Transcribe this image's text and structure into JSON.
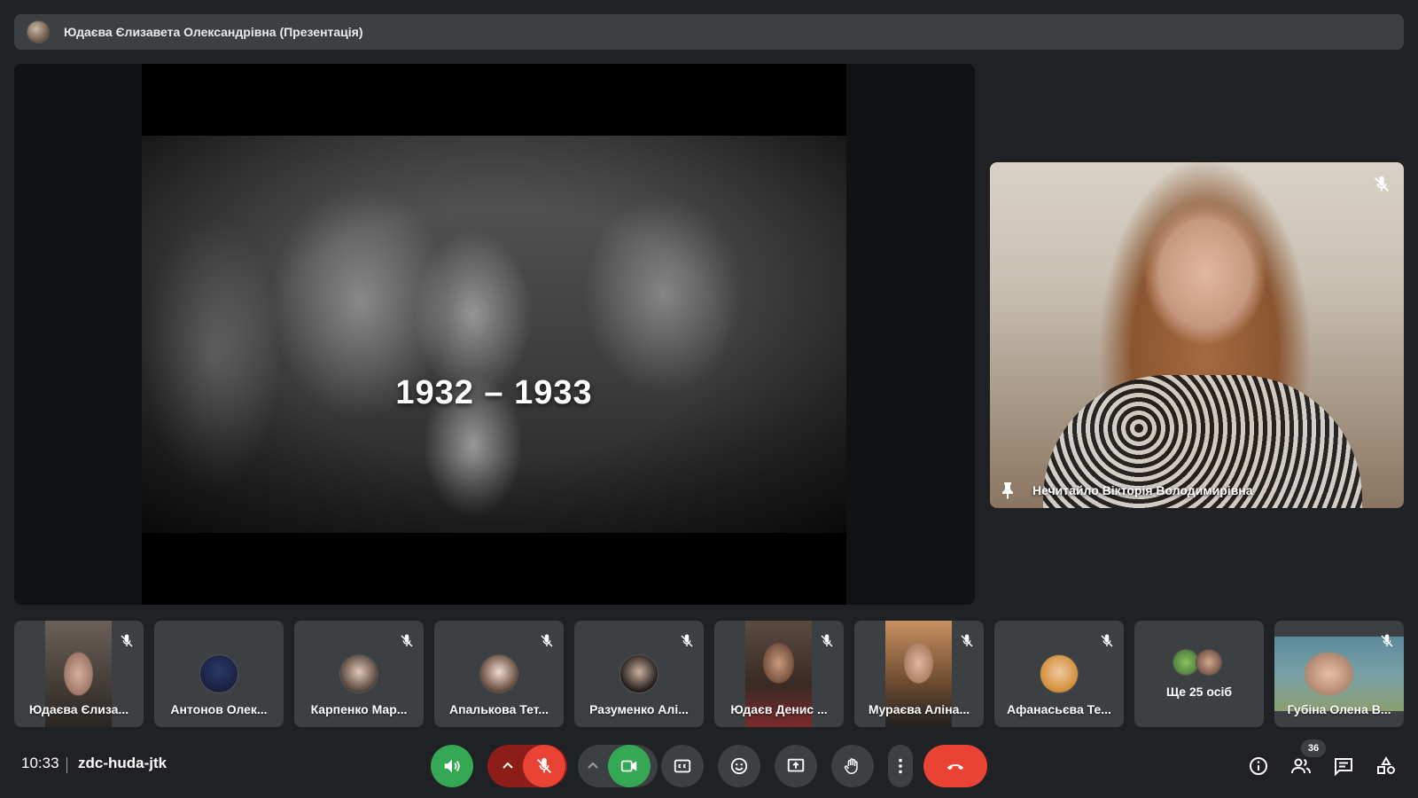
{
  "presenter": {
    "name": "Юдаєва Єлизавета Олександрівна (Презентація)"
  },
  "slide": {
    "text": "1932 – 1933"
  },
  "pinned": {
    "name": "Нечитайло Вікторія Володимирівна",
    "muted": true
  },
  "participants": [
    {
      "name": "Юдаєва Єлиза...",
      "muted": true,
      "camera": true
    },
    {
      "name": "Антонов Олек...",
      "muted": false,
      "camera": false
    },
    {
      "name": "Карпенко Мар...",
      "muted": true,
      "camera": false
    },
    {
      "name": "Апалькова Тет...",
      "muted": true,
      "camera": false
    },
    {
      "name": "Разуменко Алі...",
      "muted": true,
      "camera": false
    },
    {
      "name": "Юдаєв Денис ...",
      "muted": true,
      "camera": true
    },
    {
      "name": "Мураєва Аліна...",
      "muted": true,
      "camera": true
    },
    {
      "name": "Афанасьєва Те...",
      "muted": true,
      "camera": false
    },
    {
      "name": "Губіна Олена В...",
      "muted": true,
      "camera": true
    }
  ],
  "more": {
    "label": "Ще 25 осіб"
  },
  "bottom": {
    "time": "10:33",
    "meeting_code": "zdc-huda-jtk",
    "participant_count": "36"
  },
  "colors": {
    "background": "#202124",
    "tile": "#3c4043",
    "green": "#34a853",
    "red": "#ea4335",
    "dark_red": "#8c1d18"
  }
}
